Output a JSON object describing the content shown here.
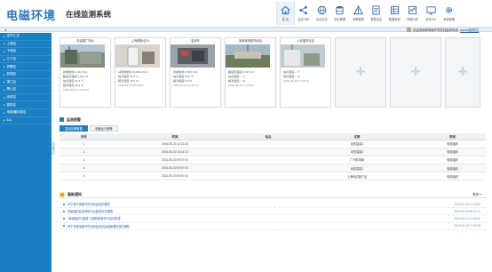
{
  "app": {
    "logo": "电磁环境",
    "subtitle": "在线监测系统"
  },
  "nav": [
    {
      "label": "首 页",
      "icon": "home-icon",
      "active": true
    },
    {
      "label": "站点分布",
      "icon": "share-icon",
      "active": false
    },
    {
      "label": "站点实况",
      "icon": "globe-icon",
      "active": false
    },
    {
      "label": "统计数据",
      "icon": "database-icon",
      "active": false
    },
    {
      "label": "告警管理",
      "icon": "warning-icon",
      "active": false
    },
    {
      "label": "报表信息",
      "icon": "report-icon",
      "active": false
    },
    {
      "label": "数据查询",
      "icon": "data-icon",
      "active": false
    },
    {
      "label": "频谱分析",
      "icon": "spectrum-icon",
      "active": false
    },
    {
      "label": "综合GIS",
      "icon": "gis-icon",
      "active": false
    },
    {
      "label": "系统管理",
      "icon": "settings-icon",
      "active": false
    }
  ],
  "topbar": {
    "left_glyph": "◂",
    "welcome": "欢迎您使用电磁环境在线监测系统",
    "username": "admin[管理员]"
  },
  "sidebar": {
    "items": [
      "全市汇总",
      "上城区",
      "下城区",
      "江干区",
      "拱墅区",
      "西湖区",
      "滨江区",
      "萧山区",
      "余杭区",
      "富阳区",
      "电磁辐射源站",
      "111"
    ],
    "toggle": "◂"
  },
  "cards": [
    {
      "title": "青溪路广场北",
      "lines": [
        "射频电场:0.743 V/m",
        "磁感应强度:0.211 μT",
        "站点温度:31.4 ℃",
        "相对湿度:46.9 %"
      ],
      "time": "2016-05-20 17:28:23"
    },
    {
      "title": "上海镇新仓23",
      "lines": [
        "μ射频电场:24.000 mV/m",
        "站点温度:33.1 ℃",
        "相对湿度:15.0 %"
      ],
      "time": "2016-05-20 20:20:01"
    },
    {
      "title": "监测车",
      "lines": [
        "射频电场:0.064 V/m",
        "站点温度:42.0 ℃",
        "相对湿度:0.0 %"
      ],
      "time": "2016-01-23 11:27:03"
    },
    {
      "title": "吴家渡电磁场测点",
      "lines": [
        "磁感应强度:0.027 μT",
        "站点温度:-- ℃",
        "相对湿度:-- %"
      ],
      "time": "2016-05-20 17:29:23"
    },
    {
      "title": "六安福湾北站",
      "lines": [
        "站点温度:-- ℃",
        "相对湿度:-- %"
      ],
      "time": "2016-05-20 17:28:23"
    }
  ],
  "empty_cards": [
    "+",
    "+",
    "+"
  ],
  "panel": {
    "title": "监测报警",
    "tabs": [
      "监测告警数据",
      "设备运行报警"
    ]
  },
  "table": {
    "headers": [
      "序号",
      "时间",
      "站点",
      "名称",
      "类别"
    ],
    "rows": [
      [
        "1",
        "2016-05-20 14:22:34",
        "",
        "余杭智能1",
        "电磁辐射"
      ],
      [
        "2",
        "2016-05-20 13:14:12",
        "",
        "余杭智能2",
        "电磁辐射"
      ],
      [
        "3",
        "2016-05-20 09:57:00",
        "",
        "广州供电局",
        "电磁辐射"
      ],
      [
        "4",
        "2016-05-20 09:57:00",
        "",
        "余杭智能1",
        "电磁辐射"
      ],
      [
        "5",
        "2016-05-20 09:57:00",
        "",
        "上海电信客户站",
        "电磁辐射"
      ]
    ]
  },
  "notices": {
    "title": "最新通知",
    "more": "更多>>",
    "items": [
      {
        "text": "关于进行电磁环境自动监测的通知",
        "date": "2016-06-18 17:09:06"
      },
      {
        "text": "电磁辐射监测网络平台建设情况通报",
        "date": "2016-06-16 08:20:12"
      },
      {
        "text": "\"电磁辐射与健康\"主题科普宣传月活动安排",
        "date": "2016-05-26 17:05:02"
      },
      {
        "text": "关于开展电磁环境自动监测站运维管理检查的通知",
        "date": "2016-05-16 17:41:09"
      }
    ]
  },
  "colors": {
    "brand": "#2c75b8",
    "sidebar": "#1b7fc3"
  }
}
